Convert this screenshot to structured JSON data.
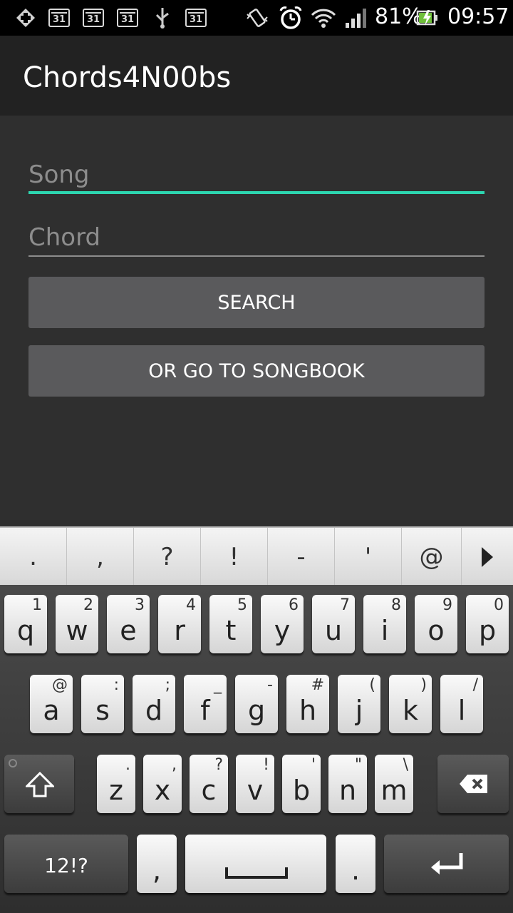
{
  "status_bar": {
    "calendar_day": "31",
    "battery": "81%",
    "time": "09:57",
    "icons": [
      "health-icon",
      "calendar-icon",
      "calendar-icon",
      "calendar-icon",
      "usb-icon",
      "calendar-icon",
      "vibrate-icon",
      "alarm-icon",
      "wifi-icon",
      "signal-icon",
      "battery-charging-icon"
    ]
  },
  "app": {
    "title": "Chords4N00bs"
  },
  "form": {
    "song_placeholder": "Song",
    "chord_placeholder": "Chord",
    "search_label": "SEARCH",
    "songbook_label": "OR GO TO SONGBOOK",
    "accent_color": "#2dd6b0"
  },
  "keyboard": {
    "suggestions": [
      ".",
      ",",
      "?",
      "!",
      "-",
      "'",
      "@"
    ],
    "row1": [
      {
        "k": "q",
        "s": "1"
      },
      {
        "k": "w",
        "s": "2"
      },
      {
        "k": "e",
        "s": "3"
      },
      {
        "k": "r",
        "s": "4"
      },
      {
        "k": "t",
        "s": "5"
      },
      {
        "k": "y",
        "s": "6"
      },
      {
        "k": "u",
        "s": "7"
      },
      {
        "k": "i",
        "s": "8"
      },
      {
        "k": "o",
        "s": "9"
      },
      {
        "k": "p",
        "s": "0"
      }
    ],
    "row2": [
      {
        "k": "a",
        "s": "@"
      },
      {
        "k": "s",
        "s": ":"
      },
      {
        "k": "d",
        "s": ";"
      },
      {
        "k": "f",
        "s": "_"
      },
      {
        "k": "g",
        "s": "-"
      },
      {
        "k": "h",
        "s": "#"
      },
      {
        "k": "j",
        "s": "("
      },
      {
        "k": "k",
        "s": ")"
      },
      {
        "k": "l",
        "s": "/"
      }
    ],
    "row3": [
      {
        "k": "z",
        "s": "."
      },
      {
        "k": "x",
        "s": ","
      },
      {
        "k": "c",
        "s": "?"
      },
      {
        "k": "v",
        "s": "!"
      },
      {
        "k": "b",
        "s": "'"
      },
      {
        "k": "n",
        "s": "\""
      },
      {
        "k": "m",
        "s": "\\"
      }
    ],
    "symbols_label": "12!?",
    "comma": ",",
    "period": "."
  }
}
